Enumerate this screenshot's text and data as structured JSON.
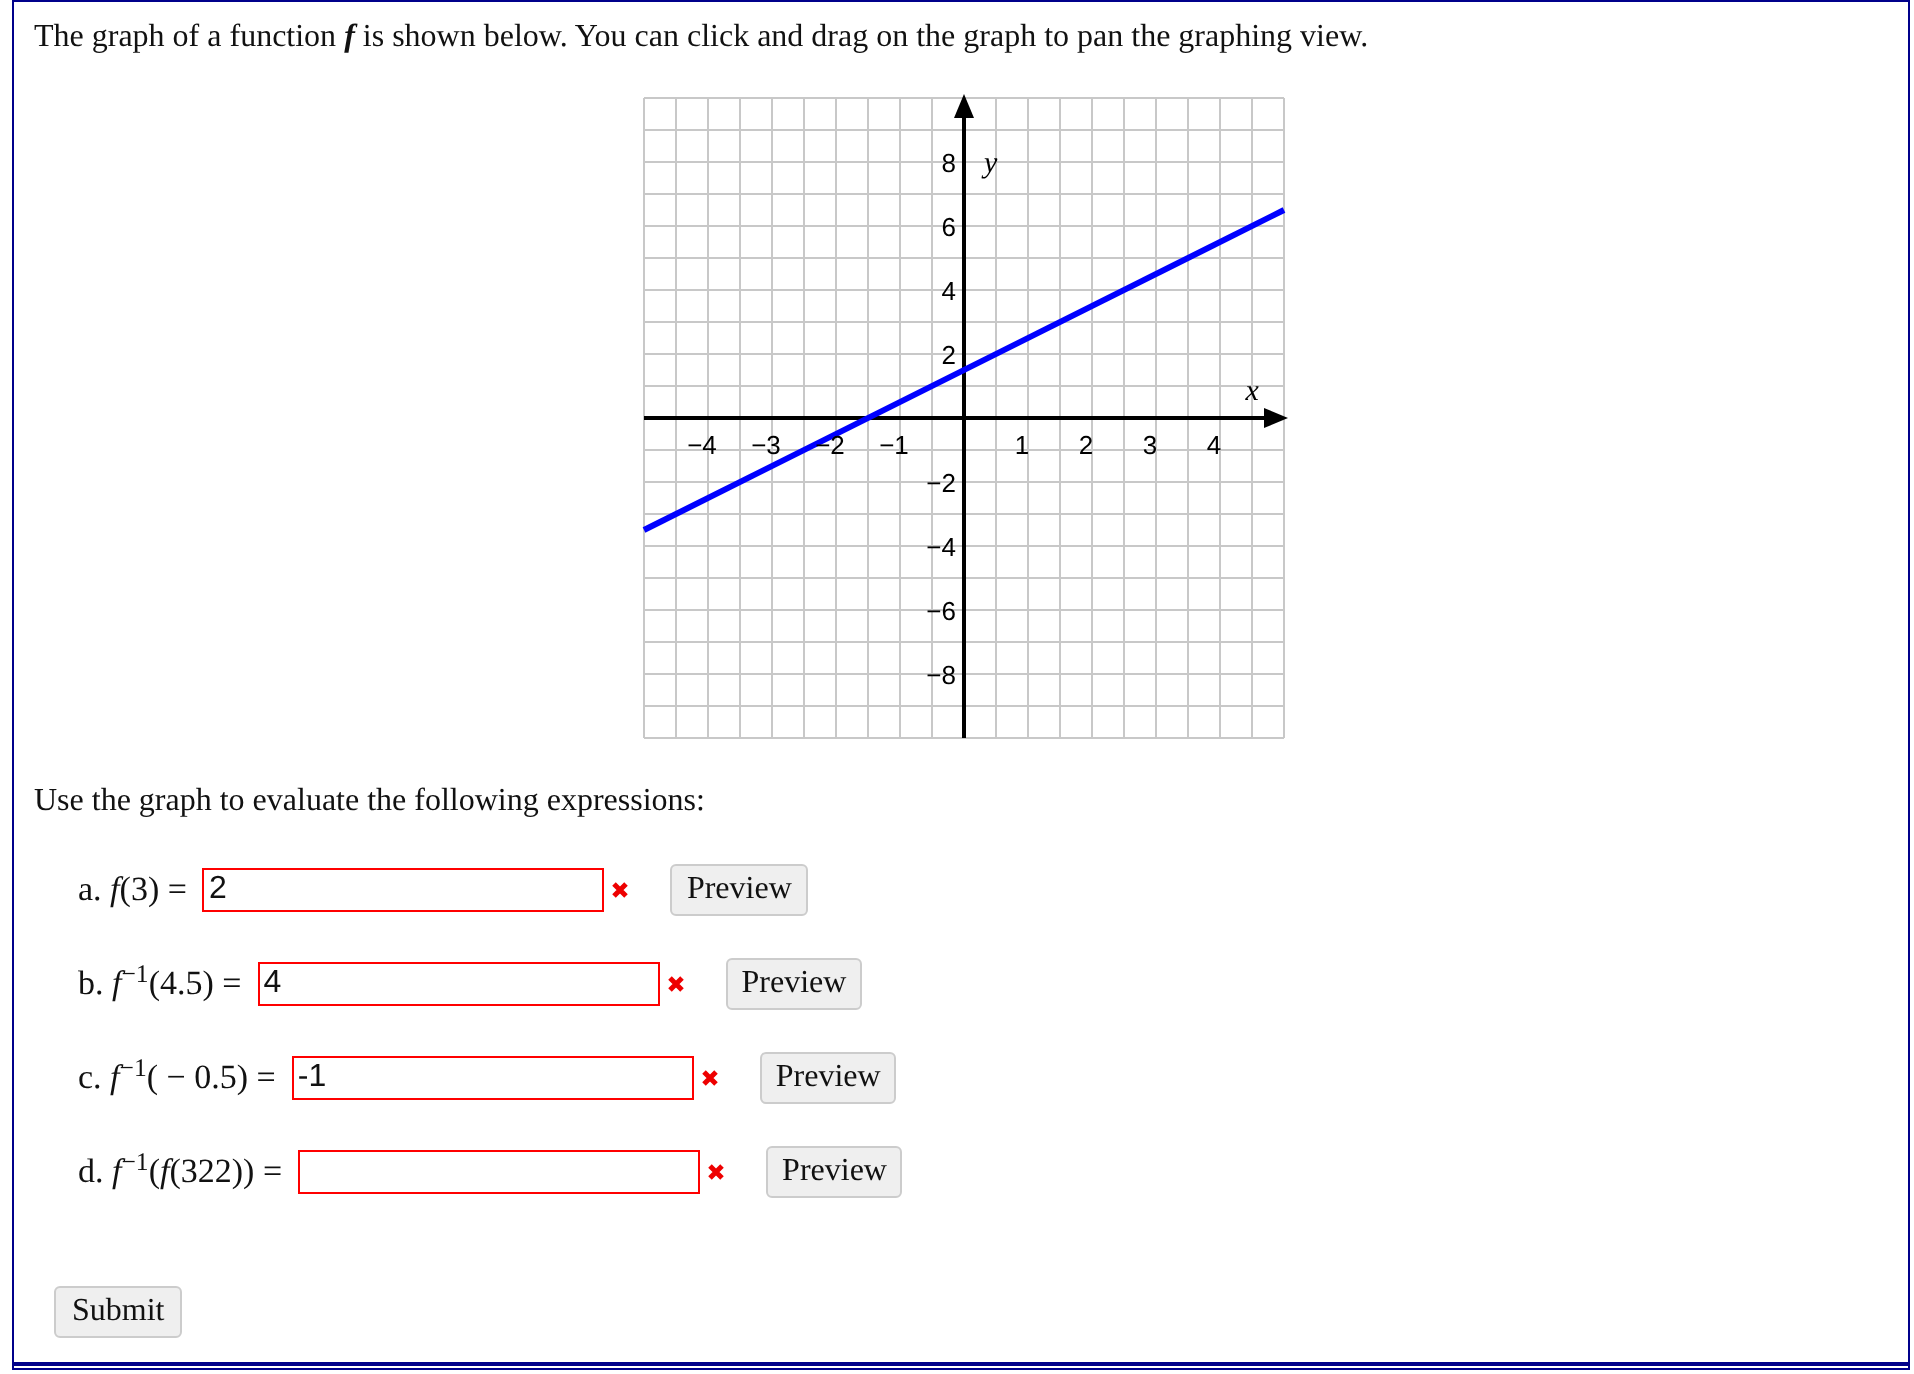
{
  "intro": "The graph of a function **f** is shown below. You can click and drag on the graph to pan the graphing view.",
  "graph": {
    "chart_data": {
      "type": "line",
      "xlabel": "x",
      "ylabel": "y",
      "x": [
        -5,
        5
      ],
      "grid": true,
      "series": [
        {
          "color": "#0000ff",
          "values": [
            -3.5,
            6.5
          ]
        }
      ],
      "xlim": [
        -5,
        5
      ],
      "ylim": [
        -10,
        10
      ],
      "xticks": [
        -4,
        -3,
        -2,
        -1,
        1,
        2,
        3,
        4
      ],
      "yticks": [
        -8,
        -6,
        -4,
        -2,
        2,
        4,
        6,
        8
      ]
    }
  },
  "instructions": "Use the graph to evaluate the following expressions:",
  "questions": [
    {
      "label": "a. *f*(3) =",
      "value": "2",
      "incorrect": true,
      "preview": "Preview"
    },
    {
      "label": "b. *f*$^{−1}$(4.5) =",
      "value": "4",
      "incorrect": true,
      "preview": "Preview"
    },
    {
      "label": "c. *f*$^{−1}$( − 0.5) =",
      "value": "-1",
      "incorrect": true,
      "preview": "Preview"
    },
    {
      "label": "d. *f*$^{−1}$(*f*(322)) =",
      "incorrect": true,
      "preview": "Preview"
    }
  ],
  "submit": "Submit"
}
